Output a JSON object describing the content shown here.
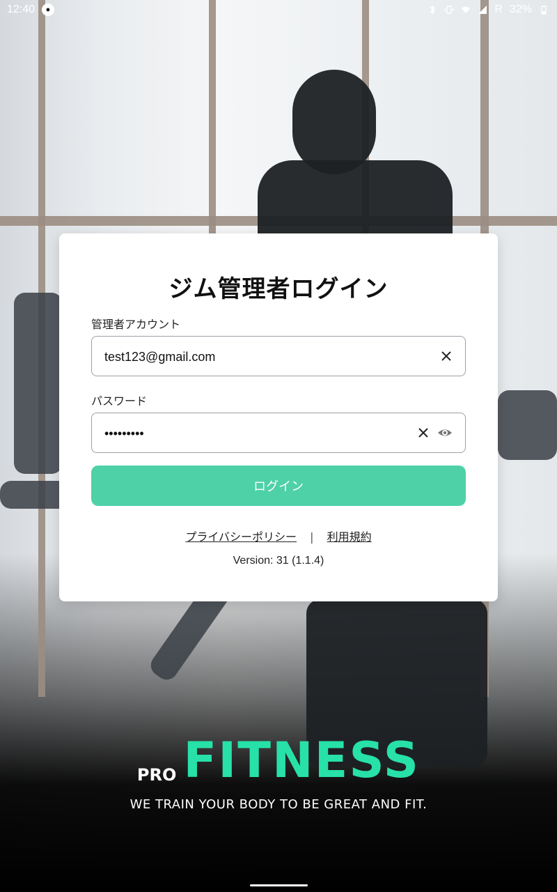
{
  "status_bar": {
    "time": "12:40",
    "battery": "32%",
    "network_label": "R"
  },
  "login_card": {
    "title": "ジム管理者ログイン",
    "account_label": "管理者アカウント",
    "account_value": "test123@gmail.com",
    "password_label": "パスワード",
    "password_value": "•••••••••",
    "login_button": "ログイン",
    "privacy_link": "プライバシーポリシー",
    "separator": "|",
    "terms_link": "利用規約",
    "version": "Version: 31 (1.1.4)"
  },
  "branding": {
    "pro": "PRO",
    "fitness": "FITNESS",
    "tagline": "WE TRAIN YOUR BODY TO BE GREAT AND FIT."
  },
  "colors": {
    "accent": "#4fd1a8",
    "brand_green": "#27e1a9",
    "card_bg": "#ffffff"
  },
  "icons": {
    "clear": "close-icon",
    "visibility": "eye-icon",
    "bluetooth": "bluetooth-icon",
    "vibrate": "vibrate-icon",
    "wifi": "wifi-icon",
    "signal": "signal-icon",
    "battery": "battery-icon"
  }
}
